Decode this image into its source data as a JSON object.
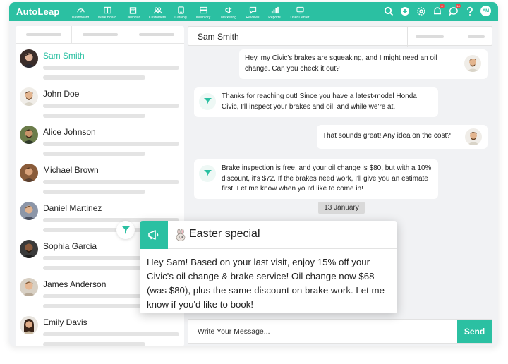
{
  "app": {
    "brand": "AutoLeap",
    "accent_color": "#2bc0a2"
  },
  "nav": [
    {
      "label": "Dashboard",
      "icon": "dashboard-icon"
    },
    {
      "label": "Work Board",
      "icon": "work-board-icon"
    },
    {
      "label": "Calendar",
      "icon": "calendar-icon"
    },
    {
      "label": "Customers",
      "icon": "customers-icon"
    },
    {
      "label": "Catalog",
      "icon": "catalog-icon"
    },
    {
      "label": "Inventory",
      "icon": "inventory-icon"
    },
    {
      "label": "Marketing",
      "icon": "marketing-icon"
    },
    {
      "label": "Reviews",
      "icon": "reviews-icon"
    },
    {
      "label": "Reports",
      "icon": "reports-icon"
    },
    {
      "label": "User Center",
      "icon": "user-center-icon"
    }
  ],
  "toolbar": {
    "avatar_initials": "AM",
    "notif_badge": "6",
    "msg_badge": "14"
  },
  "contacts": [
    {
      "name": "Sam Smith",
      "active": true
    },
    {
      "name": "John Doe"
    },
    {
      "name": "Alice Johnson"
    },
    {
      "name": "Michael Brown"
    },
    {
      "name": "Daniel Martinez"
    },
    {
      "name": "Sophia Garcia"
    },
    {
      "name": "James Anderson"
    },
    {
      "name": "Emily Davis"
    }
  ],
  "chat": {
    "title": "Sam Smith",
    "messages": [
      {
        "from": "customer",
        "text": "Hey, my Civic's brakes are squeaking, and I might need an oil change. Can you check it out?"
      },
      {
        "from": "shop",
        "text": "Thanks for reaching out! Since you have a latest-model Honda Civic, I'll inspect your brakes and oil, and while we're at."
      },
      {
        "from": "customer",
        "text": "That sounds great! Any idea on the cost?"
      },
      {
        "from": "shop",
        "text": "Brake inspection is free, and your oil change is $80, but with a 10% discount, it's $72. If the brakes need work, I'll give you an estimate first. Let me know when you'd like to come in!"
      }
    ],
    "date_chip": "13 January",
    "composer_placeholder": "Write Your Message...",
    "send_label": "Send"
  },
  "promo": {
    "title": "Easter special",
    "body": "Hey Sam! Based on your last visit, enjoy 15% off your Civic's oil change & brake service! Oil change now $68 (was $80), plus the same discount on brake work. Let me know if you'd like to book!"
  }
}
